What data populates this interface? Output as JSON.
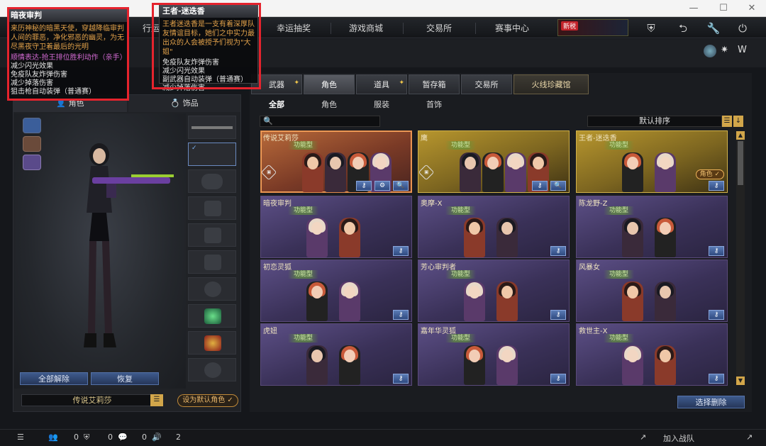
{
  "nav": {
    "items": [
      {
        "label": "行运"
      },
      {
        "label": "幸运抽奖"
      },
      {
        "label": "游戏商城"
      },
      {
        "label": "交易所"
      },
      {
        "label": "赛事中心"
      }
    ],
    "promo_new": "新税",
    "icons": [
      "shield-icon",
      "back-icon",
      "wrench-icon",
      "power-icon"
    ]
  },
  "left": {
    "tabs": [
      {
        "label": "角色"
      },
      {
        "label": "饰品"
      }
    ],
    "buttons": {
      "unequip_all": "全部解除",
      "restore": "恢复"
    },
    "char_name": "传说艾莉莎",
    "set_default": "设为默认角色 ✓"
  },
  "right": {
    "cat_tabs": [
      {
        "label": "武器"
      },
      {
        "label": "角色"
      },
      {
        "label": "道具"
      },
      {
        "label": "暂存箱"
      },
      {
        "label": "交易所"
      },
      {
        "label": "火线珍藏馆"
      }
    ],
    "sub_tabs": [
      {
        "label": "全部"
      },
      {
        "label": "角色"
      },
      {
        "label": "服装"
      },
      {
        "label": "首饰"
      }
    ],
    "sort": "默认排序",
    "cards": [
      {
        "name": "传说艾莉莎",
        "tag": "功能型"
      },
      {
        "name": "鹰",
        "tag": "功能型"
      },
      {
        "name": "王者-迷迭香",
        "tag": "功能型",
        "badge": "角色 ✓"
      },
      {
        "name": "暗夜审判",
        "tag": "功能型"
      },
      {
        "name": "奥摩-X",
        "tag": "功能型"
      },
      {
        "name": "陈龙野-Z",
        "tag": "功能型"
      },
      {
        "name": "初恋灵狐",
        "tag": "功能型"
      },
      {
        "name": "芳心审判者",
        "tag": "功能型"
      },
      {
        "name": "风暴女",
        "tag": "功能型"
      },
      {
        "name": "虎妞",
        "tag": "功能型"
      },
      {
        "name": "嘉年华灵狐",
        "tag": "功能型"
      },
      {
        "name": "救世主-X",
        "tag": "功能型"
      }
    ],
    "select_delete": "选择删除"
  },
  "bottom": {
    "counts": [
      "0",
      "0",
      "0",
      "2"
    ],
    "join_team": "加入战队"
  },
  "tooltip1": {
    "title": "暗夜审判",
    "desc": "来历神秘的暗黑天使，穿越降临审判人间的罪恶，净化邪恶的幽灵，为无尽黑夜守卫着最后的光明",
    "lines": [
      "顺情表达-抢王排位胜利动作（亲手）",
      "减少闪光效果",
      "免疫队友炸弹伤害",
      "减少掉落伤害",
      "狙击枪自动装弹（普通赛）"
    ]
  },
  "tooltip2": {
    "title": "王者-迷迭香",
    "desc": "王者迷迭香是一支有着深厚队友情谊目标，她们之中实力最出众的人会被授予们视为\"大姐\"",
    "lines": [
      "免疫队友炸弹伤害",
      "减少闪光效果",
      "副武器自动装弹（普通赛）",
      "减少掉落伤害"
    ]
  }
}
